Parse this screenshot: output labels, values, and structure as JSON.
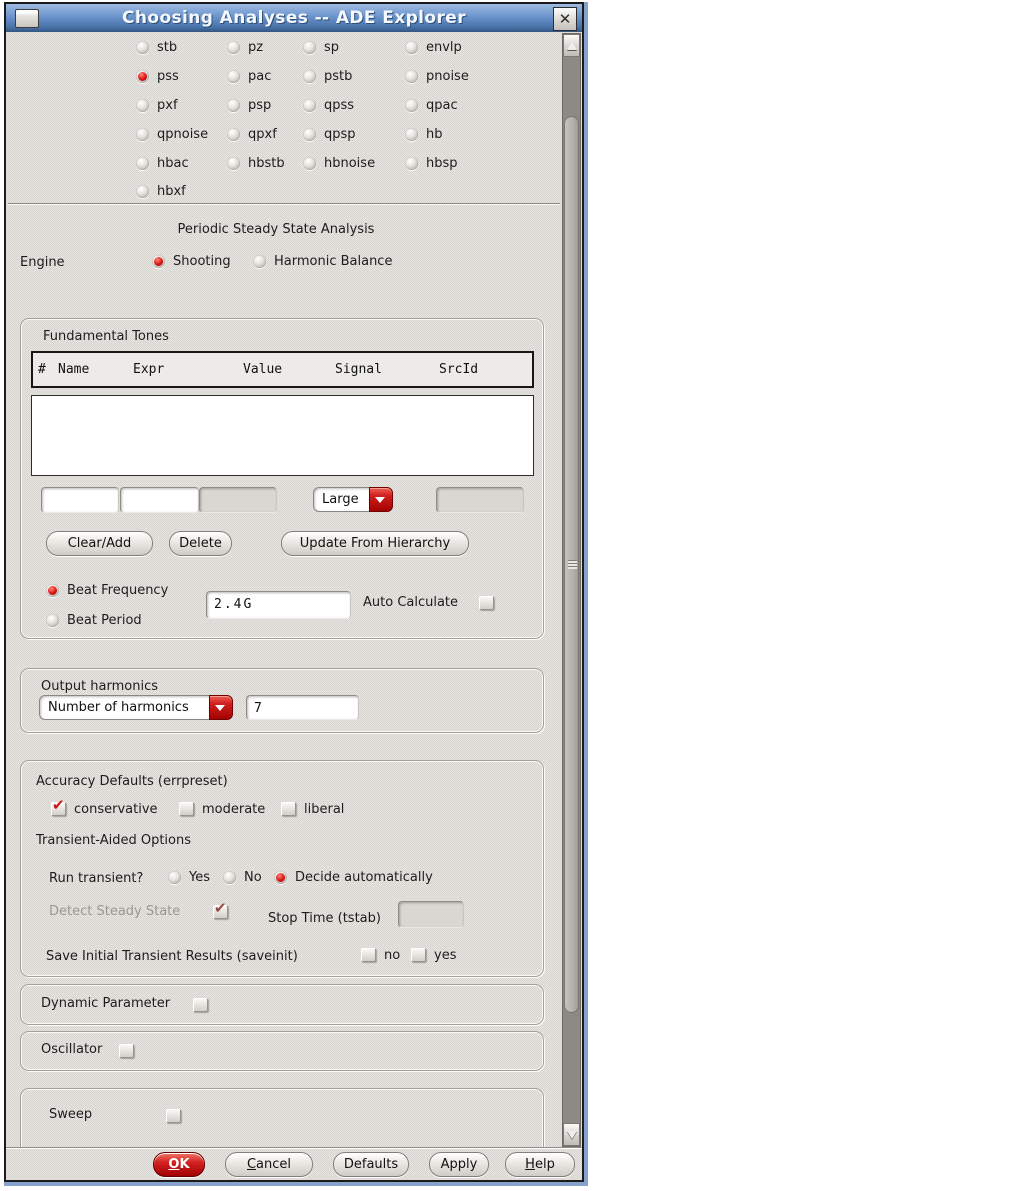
{
  "window": {
    "title": "Choosing Analyses -- ADE Explorer",
    "close_icon": "✕"
  },
  "analyses": {
    "items": [
      "stb",
      "pz",
      "sp",
      "envlp",
      "pss",
      "pac",
      "pstb",
      "pnoise",
      "pxf",
      "psp",
      "qpss",
      "qpac",
      "qpnoise",
      "qpxf",
      "qpsp",
      "hb",
      "hbac",
      "hbstb",
      "hbnoise",
      "hbsp",
      "hbxf"
    ],
    "selected": "pss"
  },
  "pss": {
    "heading": "Periodic Steady State Analysis",
    "engine": {
      "label": "Engine",
      "shooting": "Shooting",
      "harmonic_balance": "Harmonic Balance",
      "selected": "Shooting"
    }
  },
  "tones": {
    "section_label": "Fundamental Tones",
    "columns": [
      "#",
      "Name",
      "Expr",
      "Value",
      "Signal",
      "SrcId"
    ],
    "rows": [],
    "name_input": "",
    "expr_input": "",
    "size_dropdown_value": "Large",
    "buttons": {
      "clear_add": "Clear/Add",
      "delete": "Delete",
      "update": "Update From Hierarchy"
    },
    "beat_frequency_label": "Beat Frequency",
    "beat_period_label": "Beat Period",
    "beat_selected": "Beat Frequency",
    "beat_frequency_value": "2.4G",
    "auto_calculate_label": "Auto Calculate",
    "auto_calculate_checked": false
  },
  "output_harmonics": {
    "section_label": "Output harmonics",
    "mode_value": "Number of harmonics",
    "count_value": "7"
  },
  "accuracy": {
    "heading": "Accuracy Defaults (errpreset)",
    "conservative": "conservative",
    "moderate": "moderate",
    "liberal": "liberal",
    "checked": "conservative"
  },
  "transient": {
    "heading": "Transient-Aided Options",
    "run_label": "Run transient?",
    "run_yes": "Yes",
    "run_no": "No",
    "run_auto": "Decide automatically",
    "run_selected": "Decide automatically",
    "detect_label": "Detect Steady State",
    "detect_checked": true,
    "stop_time_label": "Stop Time (tstab)",
    "stop_time_value": "",
    "saveinit_label": "Save Initial Transient Results (saveinit)",
    "saveinit_no": "no",
    "saveinit_yes": "yes"
  },
  "sections": {
    "dynamic_parameter": "Dynamic Parameter",
    "oscillator": "Oscillator",
    "sweep": "Sweep"
  },
  "footer": {
    "ok": "OK",
    "cancel": "Cancel",
    "defaults": "Defaults",
    "apply": "Apply",
    "help": "Help"
  },
  "colors": {
    "accent_red": "#c40a0a",
    "titlebar_blue": "#5c86c0",
    "dialog_bg": "#d8d5d0"
  }
}
